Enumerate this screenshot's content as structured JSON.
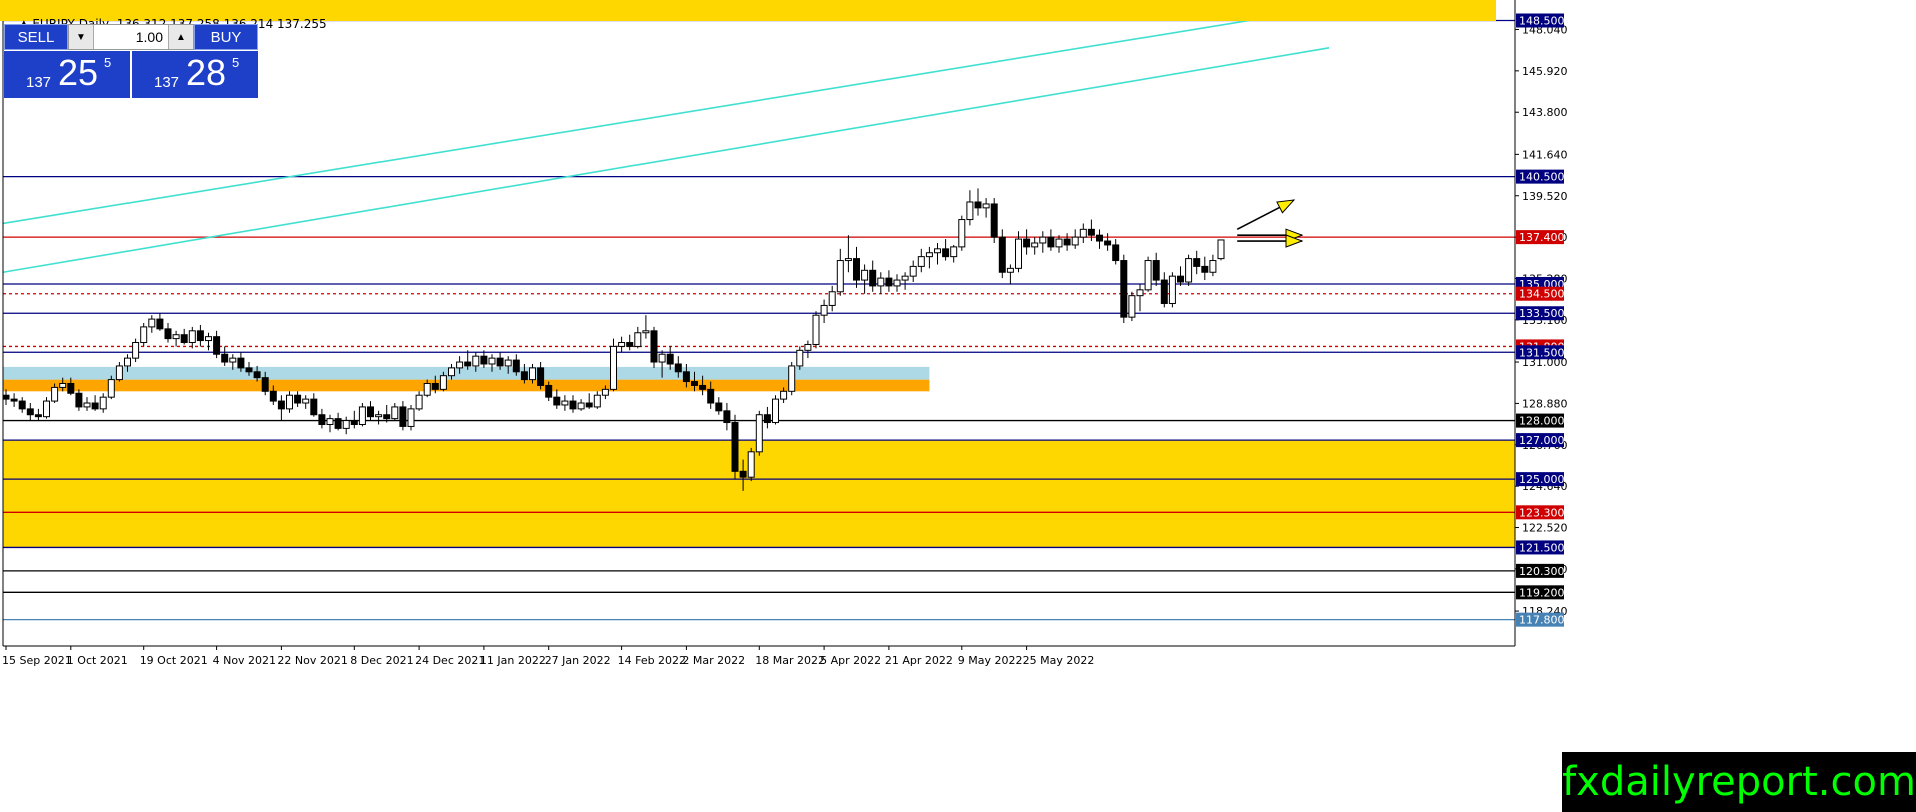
{
  "header": {
    "symbol": "EURJPY,Daily",
    "ohlc": "136.312 137.258 136.214 137.255"
  },
  "trade_panel": {
    "sell_label": "SELL",
    "buy_label": "BUY",
    "lot": "1.00",
    "spin_down": "▼",
    "spin_up": "▲",
    "sell_price": {
      "small": "137",
      "big": "25",
      "sup": "5"
    },
    "buy_price": {
      "small": "137",
      "big": "28",
      "sup": "5"
    }
  },
  "brand": "fxdailyreport.com",
  "colors": {
    "zone_yellow": "#ffd700",
    "zone_orange": "#ffa500",
    "zone_lightblue": "#add8e6",
    "channel": "#40e0d0",
    "blue_line": "#000080",
    "red_line": "#d00000",
    "arrow": "#ffee00"
  },
  "chart_data": {
    "type": "candlestick",
    "symbol": "EURJPY",
    "timeframe": "Daily",
    "ylim": [
      116.45,
      149.55
    ],
    "y_ticks": [
      "148.040",
      "145.920",
      "143.800",
      "141.640",
      "139.520",
      "137.400",
      "135.280",
      "133.160",
      "131.000",
      "128.880",
      "126.760",
      "124.640",
      "122.520",
      "120.400",
      "118.240"
    ],
    "x_labels": [
      "15 Sep 2021",
      "1 Oct 2021",
      "19 Oct 2021",
      "4 Nov 2021",
      "22 Nov 2021",
      "8 Dec 2021",
      "24 Dec 2021",
      "11 Jan 2022",
      "27 Jan 2022",
      "14 Feb 2022",
      "2 Mar 2022",
      "18 Mar 2022",
      "5 Apr 2022",
      "21 Apr 2022",
      "9 May 2022",
      "25 May 2022"
    ],
    "levels": [
      {
        "price": 148.5,
        "label": "148.500",
        "line": "#000080",
        "tag_bg": "#000080",
        "tag_fg": "#ffffff"
      },
      {
        "price": 140.5,
        "label": "140.500",
        "line": "#000080",
        "tag_bg": "#000080",
        "tag_fg": "#ffffff"
      },
      {
        "price": 137.4,
        "label": "137.400",
        "line": "#d00000",
        "tag_bg": "#d00000",
        "tag_fg": "#ffffff"
      },
      {
        "price": 135.0,
        "label": "135.000",
        "line": "#000080",
        "tag_bg": "#000080",
        "tag_fg": "#ffffff"
      },
      {
        "price": 134.5,
        "label": "134.500",
        "line": "#d00000",
        "tag_bg": "#d00000",
        "tag_fg": "#ffffff",
        "dashed": true
      },
      {
        "price": 133.5,
        "label": "133.500",
        "line": "#000080",
        "tag_bg": "#000080",
        "tag_fg": "#ffffff"
      },
      {
        "price": 131.8,
        "label": "131.800",
        "line": "#d00000",
        "tag_bg": "#d00000",
        "tag_fg": "#ffffff",
        "dashed": true
      },
      {
        "price": 131.5,
        "label": "131.500",
        "line": "#000080",
        "tag_bg": "#000080",
        "tag_fg": "#ffffff"
      },
      {
        "price": 128.0,
        "label": "128.000",
        "line": "#000000",
        "tag_bg": "#000000",
        "tag_fg": "#ffffff"
      },
      {
        "price": 127.0,
        "label": "127.000",
        "line": "#000080",
        "tag_bg": "#000080",
        "tag_fg": "#ffffff"
      },
      {
        "price": 125.0,
        "label": "125.000",
        "line": "#000080",
        "tag_bg": "#000080",
        "tag_fg": "#ffffff"
      },
      {
        "price": 123.3,
        "label": "123.300",
        "line": "#d00000",
        "tag_bg": "#d00000",
        "tag_fg": "#ffffff"
      },
      {
        "price": 121.5,
        "label": "121.500",
        "line": "#000080",
        "tag_bg": "#000080",
        "tag_fg": "#ffffff"
      },
      {
        "price": 120.3,
        "label": "120.300",
        "line": "#000000",
        "tag_bg": "#000000",
        "tag_fg": "#ffffff"
      },
      {
        "price": 119.2,
        "label": "119.200",
        "line": "#000000",
        "tag_bg": "#000000",
        "tag_fg": "#ffffff"
      },
      {
        "price": 117.8,
        "label": "117.800",
        "line": "#4682b4",
        "tag_bg": "#4682b4",
        "tag_fg": "#ffffff"
      }
    ],
    "zones": [
      {
        "from": 121.5,
        "to": 127.0,
        "color": "#ffd700"
      },
      {
        "from": 129.5,
        "to": 130.1,
        "color": "#ffa500"
      },
      {
        "from": 130.1,
        "to": 130.75,
        "color": "#add8e6"
      }
    ],
    "candles": [
      {
        "d": "15 Sep 2021",
        "o": 129.3,
        "h": 129.6,
        "l": 128.8,
        "c": 129.1
      },
      {
        "o": 129.1,
        "h": 129.4,
        "l": 128.7,
        "c": 129.0
      },
      {
        "o": 129.0,
        "h": 129.2,
        "l": 128.4,
        "c": 128.6
      },
      {
        "o": 128.6,
        "h": 128.9,
        "l": 128.0,
        "c": 128.3
      },
      {
        "o": 128.3,
        "h": 128.6,
        "l": 128.0,
        "c": 128.2
      },
      {
        "o": 128.2,
        "h": 129.2,
        "l": 128.1,
        "c": 129.0
      },
      {
        "o": 129.0,
        "h": 129.9,
        "l": 128.9,
        "c": 129.7
      },
      {
        "o": 129.7,
        "h": 130.2,
        "l": 129.5,
        "c": 129.9
      },
      {
        "d": "1 Oct 2021",
        "o": 129.9,
        "h": 130.2,
        "l": 129.3,
        "c": 129.4
      },
      {
        "o": 129.4,
        "h": 129.6,
        "l": 128.5,
        "c": 128.7
      },
      {
        "o": 128.7,
        "h": 129.2,
        "l": 128.5,
        "c": 128.9
      },
      {
        "o": 128.9,
        "h": 129.3,
        "l": 128.5,
        "c": 128.6
      },
      {
        "o": 128.6,
        "h": 129.4,
        "l": 128.4,
        "c": 129.2
      },
      {
        "o": 129.2,
        "h": 130.3,
        "l": 129.1,
        "c": 130.1
      },
      {
        "o": 130.1,
        "h": 131.0,
        "l": 130.0,
        "c": 130.8
      },
      {
        "o": 130.8,
        "h": 131.4,
        "l": 130.5,
        "c": 131.2
      },
      {
        "o": 131.2,
        "h": 132.2,
        "l": 131.0,
        "c": 132.0
      },
      {
        "d": "19 Oct 2021",
        "o": 132.0,
        "h": 133.0,
        "l": 131.8,
        "c": 132.8
      },
      {
        "o": 132.8,
        "h": 133.4,
        "l": 132.5,
        "c": 133.2
      },
      {
        "o": 133.2,
        "h": 133.5,
        "l": 132.6,
        "c": 132.7
      },
      {
        "o": 132.7,
        "h": 133.0,
        "l": 132.0,
        "c": 132.2
      },
      {
        "o": 132.2,
        "h": 132.6,
        "l": 131.8,
        "c": 132.4
      },
      {
        "o": 132.4,
        "h": 132.7,
        "l": 131.9,
        "c": 132.0
      },
      {
        "o": 132.0,
        "h": 132.8,
        "l": 131.7,
        "c": 132.6
      },
      {
        "o": 132.6,
        "h": 132.9,
        "l": 131.8,
        "c": 132.1
      },
      {
        "o": 132.1,
        "h": 132.5,
        "l": 131.6,
        "c": 132.3
      },
      {
        "d": "4 Nov 2021",
        "o": 132.3,
        "h": 132.6,
        "l": 131.2,
        "c": 131.4
      },
      {
        "o": 131.4,
        "h": 131.8,
        "l": 130.8,
        "c": 131.0
      },
      {
        "o": 131.0,
        "h": 131.4,
        "l": 130.6,
        "c": 131.2
      },
      {
        "o": 131.2,
        "h": 131.5,
        "l": 130.5,
        "c": 130.7
      },
      {
        "o": 130.7,
        "h": 131.0,
        "l": 130.3,
        "c": 130.5
      },
      {
        "o": 130.5,
        "h": 130.8,
        "l": 130.0,
        "c": 130.2
      },
      {
        "o": 130.2,
        "h": 130.5,
        "l": 129.3,
        "c": 129.5
      },
      {
        "o": 129.5,
        "h": 129.8,
        "l": 128.8,
        "c": 129.0
      },
      {
        "d": "22 Nov 2021",
        "o": 129.0,
        "h": 129.3,
        "l": 128.0,
        "c": 128.6
      },
      {
        "o": 128.6,
        "h": 129.5,
        "l": 128.4,
        "c": 129.3
      },
      {
        "o": 129.3,
        "h": 129.5,
        "l": 128.7,
        "c": 128.9
      },
      {
        "o": 128.9,
        "h": 129.3,
        "l": 128.6,
        "c": 129.1
      },
      {
        "o": 129.1,
        "h": 129.4,
        "l": 128.2,
        "c": 128.3
      },
      {
        "o": 128.3,
        "h": 128.6,
        "l": 127.6,
        "c": 127.8
      },
      {
        "o": 127.8,
        "h": 128.3,
        "l": 127.4,
        "c": 128.1
      },
      {
        "o": 128.1,
        "h": 128.4,
        "l": 127.5,
        "c": 127.6
      },
      {
        "o": 127.6,
        "h": 128.2,
        "l": 127.3,
        "c": 128.0
      },
      {
        "d": "8 Dec 2021",
        "o": 128.0,
        "h": 128.5,
        "l": 127.6,
        "c": 127.8
      },
      {
        "o": 127.8,
        "h": 128.9,
        "l": 127.7,
        "c": 128.7
      },
      {
        "o": 128.7,
        "h": 129.0,
        "l": 128.0,
        "c": 128.2
      },
      {
        "o": 128.2,
        "h": 128.5,
        "l": 127.8,
        "c": 128.3
      },
      {
        "o": 128.3,
        "h": 128.8,
        "l": 127.9,
        "c": 128.1
      },
      {
        "o": 128.1,
        "h": 128.9,
        "l": 128.0,
        "c": 128.7
      },
      {
        "o": 128.7,
        "h": 129.0,
        "l": 127.5,
        "c": 127.7
      },
      {
        "o": 127.7,
        "h": 128.8,
        "l": 127.5,
        "c": 128.6
      },
      {
        "d": "24 Dec 2021",
        "o": 128.6,
        "h": 129.5,
        "l": 128.5,
        "c": 129.3
      },
      {
        "o": 129.3,
        "h": 130.1,
        "l": 129.2,
        "c": 129.9
      },
      {
        "o": 129.9,
        "h": 130.3,
        "l": 129.4,
        "c": 129.6
      },
      {
        "o": 129.6,
        "h": 130.5,
        "l": 129.5,
        "c": 130.3
      },
      {
        "o": 130.3,
        "h": 130.9,
        "l": 130.1,
        "c": 130.7
      },
      {
        "o": 130.7,
        "h": 131.3,
        "l": 130.4,
        "c": 131.0
      },
      {
        "o": 131.0,
        "h": 131.6,
        "l": 130.6,
        "c": 130.8
      },
      {
        "o": 130.8,
        "h": 131.5,
        "l": 130.5,
        "c": 131.3
      },
      {
        "d": "11 Jan 2022",
        "o": 131.3,
        "h": 131.6,
        "l": 130.7,
        "c": 130.9
      },
      {
        "o": 130.9,
        "h": 131.4,
        "l": 130.5,
        "c": 131.2
      },
      {
        "o": 131.2,
        "h": 131.5,
        "l": 130.6,
        "c": 130.8
      },
      {
        "o": 130.8,
        "h": 131.3,
        "l": 130.4,
        "c": 131.1
      },
      {
        "o": 131.1,
        "h": 131.4,
        "l": 130.3,
        "c": 130.5
      },
      {
        "o": 130.5,
        "h": 130.9,
        "l": 129.9,
        "c": 130.1
      },
      {
        "o": 130.1,
        "h": 130.9,
        "l": 129.9,
        "c": 130.7
      },
      {
        "o": 130.7,
        "h": 131.0,
        "l": 129.6,
        "c": 129.8
      },
      {
        "d": "27 Jan 2022",
        "o": 129.8,
        "h": 130.0,
        "l": 129.0,
        "c": 129.2
      },
      {
        "o": 129.2,
        "h": 129.6,
        "l": 128.6,
        "c": 128.8
      },
      {
        "o": 128.8,
        "h": 129.3,
        "l": 128.5,
        "c": 129.0
      },
      {
        "o": 129.0,
        "h": 129.3,
        "l": 128.4,
        "c": 128.6
      },
      {
        "o": 128.6,
        "h": 129.1,
        "l": 128.5,
        "c": 128.9
      },
      {
        "o": 128.9,
        "h": 129.4,
        "l": 128.6,
        "c": 128.7
      },
      {
        "o": 128.7,
        "h": 129.5,
        "l": 128.6,
        "c": 129.3
      },
      {
        "o": 129.3,
        "h": 129.8,
        "l": 129.1,
        "c": 129.6
      },
      {
        "o": 129.6,
        "h": 132.2,
        "l": 129.5,
        "c": 131.8
      },
      {
        "d": "14 Feb 2022",
        "o": 131.8,
        "h": 132.3,
        "l": 131.5,
        "c": 132.0
      },
      {
        "o": 132.0,
        "h": 132.4,
        "l": 131.6,
        "c": 131.8
      },
      {
        "o": 131.8,
        "h": 132.8,
        "l": 131.7,
        "c": 132.5
      },
      {
        "o": 132.5,
        "h": 133.4,
        "l": 132.2,
        "c": 132.6
      },
      {
        "o": 132.6,
        "h": 132.8,
        "l": 130.7,
        "c": 131.0
      },
      {
        "o": 131.0,
        "h": 131.6,
        "l": 130.2,
        "c": 131.4
      },
      {
        "o": 131.4,
        "h": 131.8,
        "l": 130.6,
        "c": 130.9
      },
      {
        "o": 130.9,
        "h": 131.3,
        "l": 130.2,
        "c": 130.5
      },
      {
        "d": "2 Mar 2022",
        "o": 130.5,
        "h": 130.9,
        "l": 129.7,
        "c": 130.0
      },
      {
        "o": 130.0,
        "h": 130.5,
        "l": 129.5,
        "c": 129.8
      },
      {
        "o": 129.8,
        "h": 130.3,
        "l": 129.3,
        "c": 129.6
      },
      {
        "o": 129.6,
        "h": 130.0,
        "l": 128.6,
        "c": 128.9
      },
      {
        "o": 128.9,
        "h": 129.2,
        "l": 128.3,
        "c": 128.5
      },
      {
        "o": 128.5,
        "h": 128.9,
        "l": 127.5,
        "c": 127.9
      },
      {
        "o": 127.9,
        "h": 128.3,
        "l": 125.0,
        "c": 125.4
      },
      {
        "o": 125.4,
        "h": 126.0,
        "l": 124.4,
        "c": 125.1
      },
      {
        "o": 125.1,
        "h": 126.6,
        "l": 124.9,
        "c": 126.4
      },
      {
        "d": "18 Mar 2022",
        "o": 126.4,
        "h": 128.5,
        "l": 126.2,
        "c": 128.3
      },
      {
        "o": 128.3,
        "h": 128.7,
        "l": 127.6,
        "c": 127.9
      },
      {
        "o": 127.9,
        "h": 129.3,
        "l": 127.8,
        "c": 129.1
      },
      {
        "o": 129.1,
        "h": 129.7,
        "l": 128.9,
        "c": 129.5
      },
      {
        "o": 129.5,
        "h": 131.0,
        "l": 129.3,
        "c": 130.8
      },
      {
        "o": 130.8,
        "h": 131.8,
        "l": 130.6,
        "c": 131.6
      },
      {
        "o": 131.6,
        "h": 132.1,
        "l": 131.2,
        "c": 131.9
      },
      {
        "o": 131.9,
        "h": 133.6,
        "l": 131.7,
        "c": 133.4
      },
      {
        "d": "5 Apr 2022",
        "o": 133.4,
        "h": 134.2,
        "l": 133.0,
        "c": 133.9
      },
      {
        "o": 133.9,
        "h": 134.9,
        "l": 133.6,
        "c": 134.6
      },
      {
        "o": 134.6,
        "h": 136.8,
        "l": 134.4,
        "c": 136.2
      },
      {
        "o": 136.2,
        "h": 137.5,
        "l": 135.6,
        "c": 136.3
      },
      {
        "o": 136.3,
        "h": 136.9,
        "l": 134.8,
        "c": 135.2
      },
      {
        "o": 135.2,
        "h": 136.0,
        "l": 134.5,
        "c": 135.7
      },
      {
        "o": 135.7,
        "h": 136.2,
        "l": 134.6,
        "c": 134.9
      },
      {
        "o": 134.9,
        "h": 135.6,
        "l": 134.5,
        "c": 135.3
      },
      {
        "d": "21 Apr 2022",
        "o": 135.3,
        "h": 135.7,
        "l": 134.6,
        "c": 134.9
      },
      {
        "o": 134.9,
        "h": 135.5,
        "l": 134.6,
        "c": 135.2
      },
      {
        "o": 135.2,
        "h": 135.6,
        "l": 134.7,
        "c": 135.4
      },
      {
        "o": 135.4,
        "h": 136.2,
        "l": 135.1,
        "c": 135.9
      },
      {
        "o": 135.9,
        "h": 136.8,
        "l": 135.6,
        "c": 136.4
      },
      {
        "o": 136.4,
        "h": 136.9,
        "l": 135.8,
        "c": 136.6
      },
      {
        "o": 136.6,
        "h": 137.1,
        "l": 136.0,
        "c": 136.8
      },
      {
        "o": 136.8,
        "h": 137.3,
        "l": 136.2,
        "c": 136.4
      },
      {
        "o": 136.4,
        "h": 137.0,
        "l": 136.1,
        "c": 136.9
      },
      {
        "d": "9 May 2022",
        "o": 136.9,
        "h": 138.5,
        "l": 136.7,
        "c": 138.3
      },
      {
        "o": 138.3,
        "h": 139.8,
        "l": 138.0,
        "c": 139.2
      },
      {
        "o": 139.2,
        "h": 139.9,
        "l": 138.5,
        "c": 138.9
      },
      {
        "o": 138.9,
        "h": 139.4,
        "l": 138.4,
        "c": 139.1
      },
      {
        "o": 139.1,
        "h": 139.4,
        "l": 137.1,
        "c": 137.4
      },
      {
        "o": 137.4,
        "h": 137.8,
        "l": 135.3,
        "c": 135.6
      },
      {
        "o": 135.6,
        "h": 136.0,
        "l": 135.0,
        "c": 135.8
      },
      {
        "o": 135.8,
        "h": 137.7,
        "l": 135.6,
        "c": 137.3
      },
      {
        "d": "25 May 2022",
        "o": 137.3,
        "h": 137.8,
        "l": 136.5,
        "c": 136.9
      },
      {
        "o": 136.9,
        "h": 137.4,
        "l": 136.5,
        "c": 137.1
      },
      {
        "o": 137.1,
        "h": 137.7,
        "l": 136.6,
        "c": 137.4
      },
      {
        "o": 137.4,
        "h": 137.8,
        "l": 136.7,
        "c": 136.9
      },
      {
        "o": 136.9,
        "h": 137.5,
        "l": 136.6,
        "c": 137.3
      },
      {
        "o": 137.3,
        "h": 137.6,
        "l": 136.7,
        "c": 137.0
      },
      {
        "o": 137.0,
        "h": 137.8,
        "l": 136.8,
        "c": 137.4
      },
      {
        "o": 137.4,
        "h": 138.1,
        "l": 137.1,
        "c": 137.8
      },
      {
        "o": 137.8,
        "h": 138.3,
        "l": 137.2,
        "c": 137.5
      },
      {
        "o": 137.5,
        "h": 137.8,
        "l": 136.8,
        "c": 137.2
      },
      {
        "o": 137.2,
        "h": 137.6,
        "l": 136.7,
        "c": 137.0
      },
      {
        "o": 137.0,
        "h": 137.3,
        "l": 136.0,
        "c": 136.2
      },
      {
        "o": 136.2,
        "h": 136.5,
        "l": 133.0,
        "c": 133.3
      },
      {
        "o": 133.3,
        "h": 134.6,
        "l": 133.1,
        "c": 134.4
      },
      {
        "o": 134.4,
        "h": 135.0,
        "l": 133.6,
        "c": 134.7
      },
      {
        "o": 134.7,
        "h": 136.4,
        "l": 134.6,
        "c": 136.2
      },
      {
        "o": 136.2,
        "h": 136.6,
        "l": 134.9,
        "c": 135.2
      },
      {
        "o": 135.2,
        "h": 135.6,
        "l": 133.8,
        "c": 134.0
      },
      {
        "o": 134.0,
        "h": 135.6,
        "l": 133.8,
        "c": 135.4
      },
      {
        "o": 135.4,
        "h": 135.9,
        "l": 134.9,
        "c": 135.1
      },
      {
        "o": 135.1,
        "h": 136.5,
        "l": 134.9,
        "c": 136.3
      },
      {
        "o": 136.3,
        "h": 136.7,
        "l": 135.5,
        "c": 135.9
      },
      {
        "o": 135.9,
        "h": 136.4,
        "l": 135.2,
        "c": 135.6
      },
      {
        "o": 135.6,
        "h": 136.5,
        "l": 135.4,
        "c": 136.2
      },
      {
        "o": 136.3,
        "h": 137.26,
        "l": 136.21,
        "c": 137.255
      }
    ],
    "channel_lines": [
      {
        "from_candle": 0,
        "from_price": 138.1,
        "to_candle": 150,
        "to_price": 149.1
      },
      {
        "from_candle": 0,
        "from_price": 135.6,
        "to_candle": 151,
        "to_price": 147.1
      }
    ],
    "arrows": [
      {
        "from_candle": 152,
        "from_price": 137.8,
        "to_candle": 159,
        "to_price": 139.3
      },
      {
        "from_candle": 152,
        "from_price": 137.5,
        "to_candle": 160,
        "to_price": 137.5
      },
      {
        "from_candle": 152,
        "from_price": 137.2,
        "to_candle": 160,
        "to_price": 137.2
      }
    ]
  }
}
